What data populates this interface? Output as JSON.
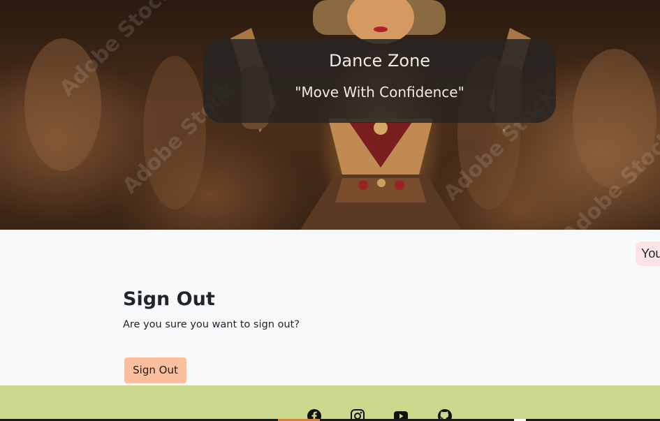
{
  "hero": {
    "title": "Dance Zone",
    "tagline": "\"Move With Confidence\"",
    "watermark": "Adobe Stock"
  },
  "toast": {
    "text": "You"
  },
  "signout": {
    "title": "Sign Out",
    "message": "Are you sure you want to sign out?",
    "button_label": "Sign Out"
  },
  "footer": {
    "social_icons": [
      "facebook-icon",
      "instagram-icon",
      "youtube-icon",
      "github-icon"
    ]
  },
  "colors": {
    "page_background": "#f8f9fa",
    "button": "#fcbf9e",
    "footer": "#cad98c",
    "toast": "#fbe4e4"
  }
}
